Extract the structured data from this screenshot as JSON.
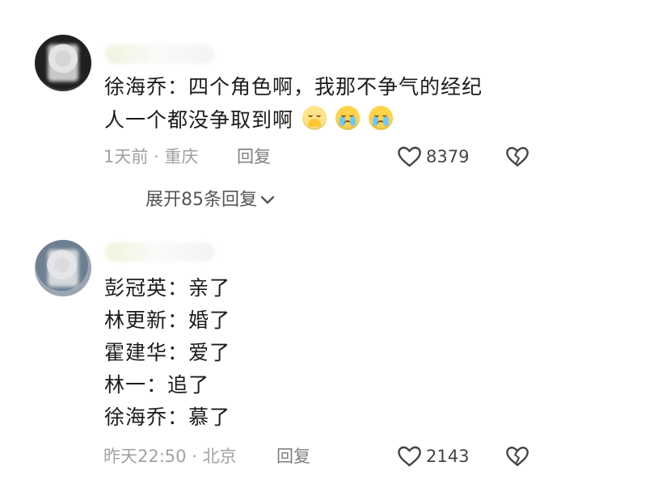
{
  "comments": [
    {
      "lines": [
        "徐海乔：四个角色啊，我那不争气的经纪",
        "人一个都没争取到啊"
      ],
      "meta": "1天前 · 重庆",
      "reply_label": "回复",
      "likes": "8379",
      "expand_label": "展开85条回复"
    },
    {
      "lines": [
        "彭冠英：亲了",
        "林更新：婚了",
        "霍建华：爱了",
        "林一：追了",
        "徐海乔：慕了"
      ],
      "meta": "昨天22:50 · 北京",
      "reply_label": "回复",
      "likes": "2143"
    }
  ],
  "icons": {
    "heart": "heart-outline-icon",
    "dislike": "broken-heart-icon",
    "expand": "chevron-down-icon",
    "emoji_1": "holding-back-tears-emoji",
    "emoji_2": "crying-face-emoji"
  },
  "colors": {
    "text": "#1b1b1b",
    "meta": "#a2a2a2",
    "secondary": "#555555"
  }
}
